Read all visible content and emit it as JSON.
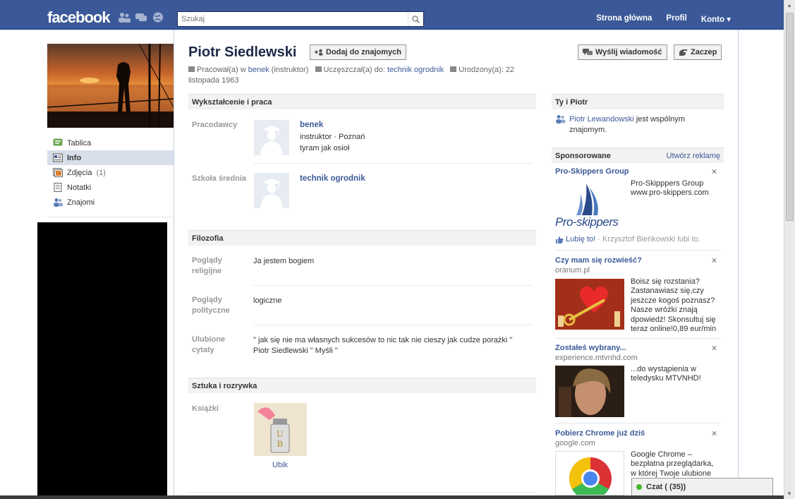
{
  "header": {
    "logo": "facebook",
    "search_placeholder": "Szukaj",
    "nav": [
      "Strona główna",
      "Profil",
      "Konto ▾"
    ]
  },
  "left_nav": [
    {
      "label": "Tablica",
      "count": ""
    },
    {
      "label": "Info",
      "count": "",
      "active": true
    },
    {
      "label": "Zdjęcia",
      "count": "(1)"
    },
    {
      "label": "Notatki",
      "count": ""
    },
    {
      "label": "Znajomi",
      "count": ""
    }
  ],
  "profile": {
    "name": "Piotr Siedlewski",
    "add_friend": "Dodaj do znajomych",
    "send_message": "Wyślij wiadomość",
    "poke": "Zaczep",
    "worked_prefix": "Pracował(a) w",
    "worked_at": "benek",
    "worked_role": "(instruktor)",
    "school_prefix": "Uczęszczał(a) do:",
    "school": "technik ogrodnik",
    "born": "Urodzony(a): 22 listopada 1963"
  },
  "education_work": {
    "title": "Wykształcenie i praca",
    "employers_label": "Pracodawcy",
    "employer_name": "benek",
    "employer_meta": "instruktor · Poznań",
    "employer_desc": "tyram jak osioł",
    "highschool_label": "Szkoła średnia",
    "highschool_name": "technik ogrodnik"
  },
  "philosophy": {
    "title": "Filozofia",
    "religious_label": "Poglądy religijne",
    "religious_value": "Ja jestem bogiem",
    "political_label": "Poglądy polityczne",
    "political_value": "logiczne",
    "quotes_label": "Ulubione cytaty",
    "quotes_value": "\" jak się nie ma własnych sukcesów to nic tak nie cieszy jak cudze porażki \" Piotr Siedlewski \" Myśli \""
  },
  "arts": {
    "title": "Sztuka i rozrywka",
    "books_label": "Książki",
    "book_title": "Ubik"
  },
  "sidebar": {
    "you_and_title": "Ty i Piotr",
    "mutual_friend": "Piotr Lewandowski",
    "mutual_text": "jest wspólnym znajomym.",
    "sponsored_title": "Sponsorowane",
    "create_ad": "Utwórz reklamę",
    "ads": [
      {
        "title": "Pro-Skippers Group",
        "text": "Pro-Skipppers Group www.pro-skippers.com",
        "logo_text": "Pro-skippers",
        "like": "Lubię to!",
        "like_by": "· Krzysztof Bieńkowski lubi to."
      },
      {
        "title": "Czy mam się rozwieść?",
        "domain": "oranum.pl",
        "text": "Boisz się rozstania? Zastanawiasz się,czy jeszcze kogoś poznasz? Nasze wróżki znają dpowiedź! Skonsultuj się teraz online!0,89 eur/min"
      },
      {
        "title": "Zostałeś wybrany...",
        "domain": "experience.mtvnhd.com",
        "text": "...do wystąpienia w teledysku MTVNHD!"
      },
      {
        "title": "Pobierz Chrome już dziś",
        "domain": "google.com",
        "text": "Google Chrome – bezpłatna przeglądarka, w której Twoje ulubione"
      }
    ]
  },
  "chat": {
    "label": "Czat ( (35))"
  },
  "colors": {
    "brand": "#3b5998",
    "section_bg": "#f2f2f2",
    "active_nav": "#d8dfea"
  }
}
